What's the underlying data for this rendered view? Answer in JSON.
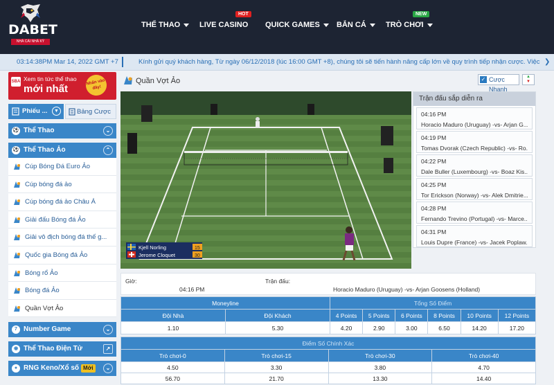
{
  "header": {
    "brand": "DABET",
    "tagline": "NHÀ CÁI NHÀ KỲ",
    "nav": [
      {
        "label": "THỂ THAO",
        "caret": true
      },
      {
        "label": "LIVE CASINO",
        "caret": false,
        "badge": "HOT"
      },
      {
        "label": "QUICK GAMES",
        "caret": true
      },
      {
        "label": "BẮN CÁ",
        "caret": true
      },
      {
        "label": "TRÒ CHƠI",
        "caret": true,
        "badge": "NEW"
      }
    ]
  },
  "ticker": {
    "datetime": "03:14:38PM Mar 14, 2022 GMT +7",
    "message": "Kính gửi quý khách hàng, Từ ngày 06/12/2018 (lúc 16:00 GMT +8), chúng tôi sẽ tiến hành nâng cấp lớn về quy trình tiếp nhận cược. Việc nâng cấp này"
  },
  "sidebar": {
    "promo": {
      "small": "Xem tin tức thể thao",
      "big": "mới nhất",
      "sticker": "Nhấn vào đây!",
      "logo": "SBA"
    },
    "ticket_label": "Phiếu ...",
    "odds_label": "Bảng Cược",
    "sections": [
      {
        "label": "Thể Thao"
      },
      {
        "label": "Thể Thao Ảo"
      }
    ],
    "sub_items": [
      "Cúp Bóng Đá Euro Ảo",
      "Cúp bóng đá ảo",
      "Cúp bóng đá ảo Châu Á",
      "Giải đấu Bóng đá Ảo",
      "Giải vô địch bóng đá thế g...",
      "Quốc gia Bóng đá Ảo",
      "Bóng rổ Ảo",
      "Bóng đá Ảo",
      "Quần Vợt Ảo"
    ],
    "bottom_sections": [
      {
        "label": "Number Game"
      },
      {
        "label": "Thể Thao Điện Tử"
      },
      {
        "label": "RNG Keno/Xổ số",
        "badge": "Mới"
      }
    ]
  },
  "main": {
    "title": "Quần Vợt Ảo",
    "quick_bet": "Cược Nhanh",
    "video": {
      "player1": "Kjell Norling",
      "player2": "Jerome Cloquet",
      "score1": "15",
      "score2": "30"
    },
    "upcoming": {
      "header": "Trận đấu sắp diễn ra",
      "matches": [
        {
          "time": "04:16 PM",
          "name": "Horacio Maduro (Uruguay) -vs- Arjan G..."
        },
        {
          "time": "04:19 PM",
          "name": "Tomas Dvorak (Czech Republic) -vs- Ro..."
        },
        {
          "time": "04:22 PM",
          "name": "Dale Buller (Luxembourg) -vs- Boaz Kis..."
        },
        {
          "time": "04:25 PM",
          "name": "Tor Erickson (Norway) -vs- Alek Dmitrie..."
        },
        {
          "time": "04:28 PM",
          "name": "Fernando Trevino (Portugal) -vs- Marce..."
        },
        {
          "time": "04:31 PM",
          "name": "Louis Dupre (France) -vs- Jacek Poplaw..."
        }
      ]
    },
    "info": {
      "time_label": "Giờ:",
      "time_value": "04:16 PM",
      "match_label": "Trận đấu:",
      "match_value": "Horacio Maduro (Uruguay) -vs- Arjan Goosens (Holland)"
    },
    "moneyline": {
      "header": "Moneyline",
      "home_label": "Đội Nhà",
      "away_label": "Đội Khách",
      "home": "1.10",
      "away": "5.30"
    },
    "total_points": {
      "header": "Tổng Số Điểm",
      "columns": [
        "4 Points",
        "5 Points",
        "6 Points",
        "8 Points",
        "10 Points",
        "12 Points"
      ],
      "values": [
        "4.20",
        "2.90",
        "3.00",
        "6.50",
        "14.20",
        "17.20"
      ]
    },
    "correct_score": {
      "header": "Điểm Số Chính Xác",
      "columns": [
        "Trò chơi-0",
        "Trò chơi-15",
        "Trò chơi-30",
        "Trò chơi-40"
      ],
      "row1": [
        "4.50",
        "3.30",
        "3.80",
        "4.70"
      ],
      "row2": [
        "56.70",
        "21.70",
        "13.30",
        "14.40"
      ]
    }
  }
}
